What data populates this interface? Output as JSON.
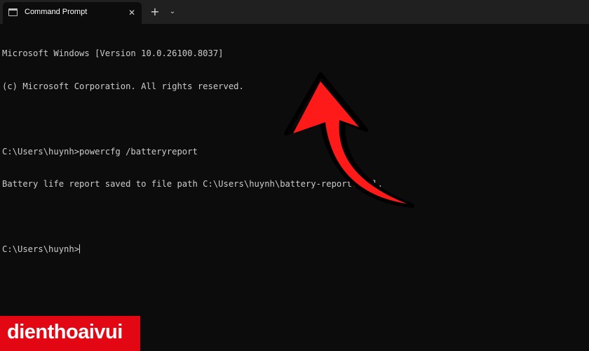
{
  "window": {
    "tab_title": "Command Prompt",
    "close_glyph": "✕",
    "new_tab_glyph": "+",
    "dropdown_glyph": "⌄"
  },
  "terminal": {
    "lines": [
      "Microsoft Windows [Version 10.0.26100.8037]",
      "(c) Microsoft Corporation. All rights reserved.",
      "",
      "C:\\Users\\huynh>powercfg /batteryreport",
      "Battery life report saved to file path C:\\Users\\huynh\\battery-report.html.",
      "",
      "C:\\Users\\huynh>"
    ]
  },
  "watermark": {
    "text": "dienthoaivui"
  },
  "colors": {
    "background": "#0c0c0c",
    "tabbar": "#202020",
    "text": "#cccccc",
    "arrow": "#ff1a1a",
    "logo_bg": "#e30613"
  },
  "icons": [
    "terminal-icon",
    "close-icon",
    "plus-icon",
    "chevron-down-icon",
    "arrow-icon"
  ]
}
